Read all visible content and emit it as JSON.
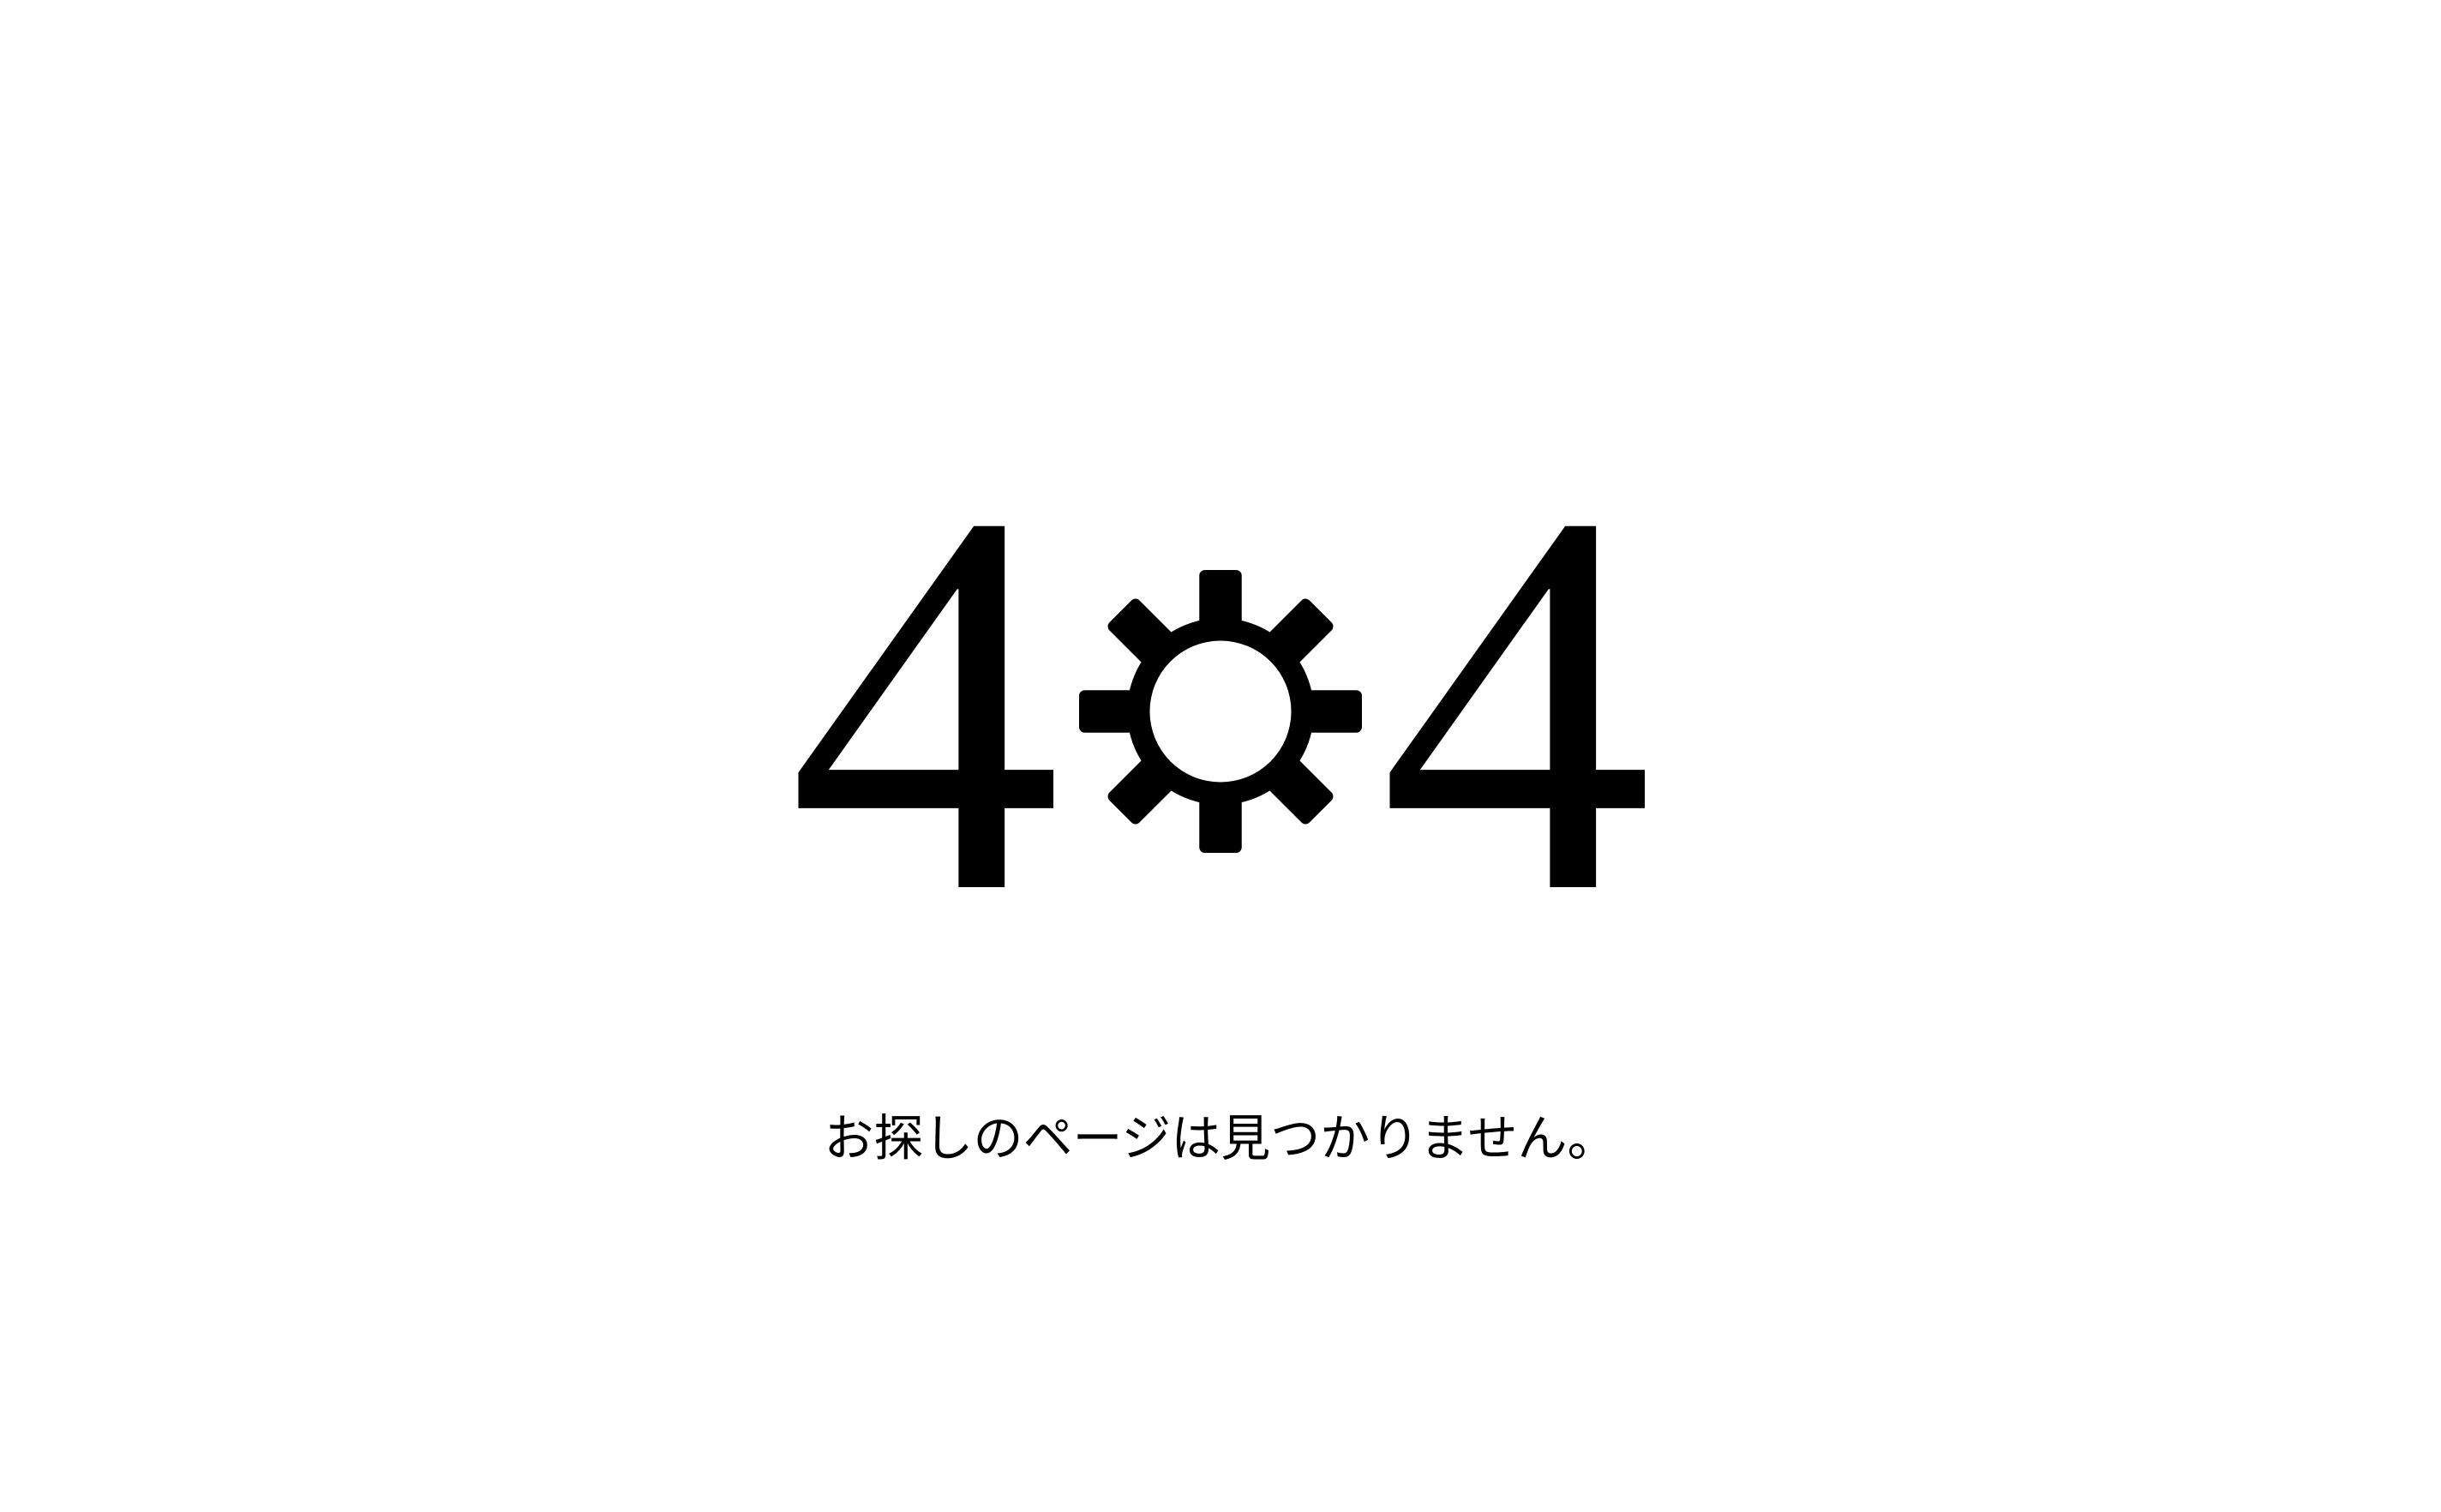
{
  "error": {
    "digit_left": "4",
    "digit_right": "4",
    "middle_icon": "gear-icon"
  },
  "message": "お探しのページは見つかりません。",
  "colors": {
    "background": "#ffffff",
    "foreground": "#000000"
  }
}
